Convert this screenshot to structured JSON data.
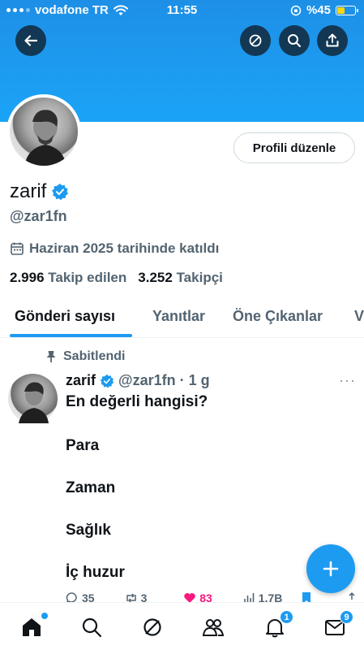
{
  "status_bar": {
    "carrier": "vodafone TR",
    "time": "11:55",
    "battery_percent": "%45",
    "battery_level": 0.45
  },
  "header": {
    "back_icon": "arrow-left-icon",
    "grok_icon": "grok-icon",
    "search_icon": "search-icon",
    "share_icon": "share-icon"
  },
  "profile": {
    "edit_button": "Profili düzenle",
    "name": "zarif",
    "handle": "@zar1fn",
    "joined": "Haziran 2025 tarihinde katıldı",
    "following_count": "2.996",
    "following_label": "Takip edilen",
    "followers_count": "3.252",
    "followers_label": "Takipçi"
  },
  "tabs": [
    {
      "label": "Gönderi sayısı"
    },
    {
      "label": "Yanıtlar"
    },
    {
      "label": "Öne Çıkanlar"
    },
    {
      "label": "V"
    }
  ],
  "post": {
    "pinned_label": "Sabitlendi",
    "author": "zarif",
    "handle_time": "@zar1fn · 1 g",
    "more": "···",
    "lines": [
      "En değerli hangisi?",
      "Para",
      "Zaman",
      "Sağlık",
      "İç huzur"
    ],
    "replies": "35",
    "reposts": "3",
    "likes": "83",
    "views": "1,7B"
  },
  "bottom_nav": {
    "notifications_badge": "1",
    "messages_badge": "9"
  },
  "colors": {
    "accent": "#1d9bf0",
    "like": "#f91880",
    "header_bg": "#1d9bf0"
  }
}
